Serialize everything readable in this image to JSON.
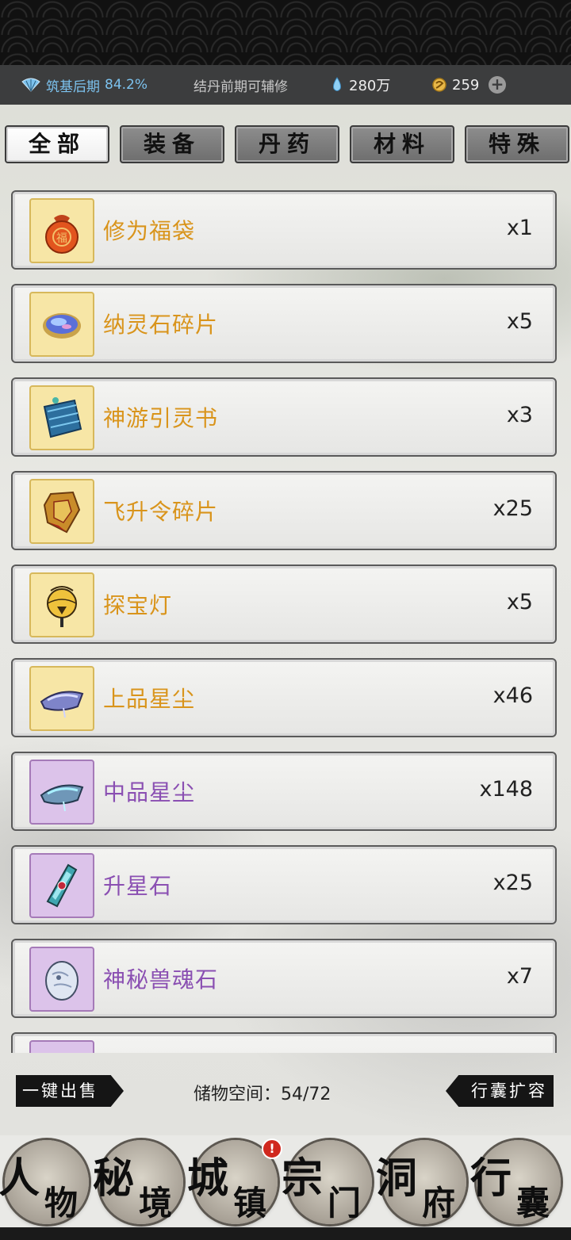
{
  "status": {
    "realm": "筑基后期",
    "progress": "84.2%",
    "assist": "结丹前期可辅修",
    "spirit_stone": "280万",
    "coins": "259"
  },
  "tabs": [
    {
      "label": "全部",
      "active": true
    },
    {
      "label": "装备",
      "active": false
    },
    {
      "label": "丹药",
      "active": false
    },
    {
      "label": "材料",
      "active": false
    },
    {
      "label": "特殊",
      "active": false
    }
  ],
  "items": [
    {
      "name": "修为福袋",
      "count": "x1",
      "rarity": "gold",
      "icon": "lucky-bag-icon"
    },
    {
      "name": "纳灵石碎片",
      "count": "x5",
      "rarity": "gold",
      "icon": "spirit-stone-fragment-icon"
    },
    {
      "name": "神游引灵书",
      "count": "x3",
      "rarity": "gold",
      "icon": "scroll-icon"
    },
    {
      "name": "飞升令碎片",
      "count": "x25",
      "rarity": "gold",
      "icon": "token-fragment-icon"
    },
    {
      "name": "探宝灯",
      "count": "x5",
      "rarity": "gold",
      "icon": "lantern-icon"
    },
    {
      "name": "上品星尘",
      "count": "x46",
      "rarity": "gold",
      "icon": "stardust-icon"
    },
    {
      "name": "中品星尘",
      "count": "x148",
      "rarity": "purple",
      "icon": "stardust-icon"
    },
    {
      "name": "升星石",
      "count": "x25",
      "rarity": "purple",
      "icon": "star-stone-icon"
    },
    {
      "name": "神秘兽魂石",
      "count": "x7",
      "rarity": "purple",
      "icon": "beast-soul-stone-icon"
    }
  ],
  "bottom": {
    "sell_label": "一键出售",
    "storage": "储物空间：54/72",
    "expand_label": "行囊扩容"
  },
  "nav": [
    {
      "c1": "人",
      "c2": "物"
    },
    {
      "c1": "秘",
      "c2": "境"
    },
    {
      "c1": "城",
      "c2": "镇",
      "badge": "!"
    },
    {
      "c1": "宗",
      "c2": "门"
    },
    {
      "c1": "洞",
      "c2": "府"
    },
    {
      "c1": "行",
      "c2": "囊"
    }
  ],
  "colors": {
    "gold_name": "#d9941b",
    "purple_name": "#8a4fb2",
    "realm_blue": "#7cc2ee"
  }
}
